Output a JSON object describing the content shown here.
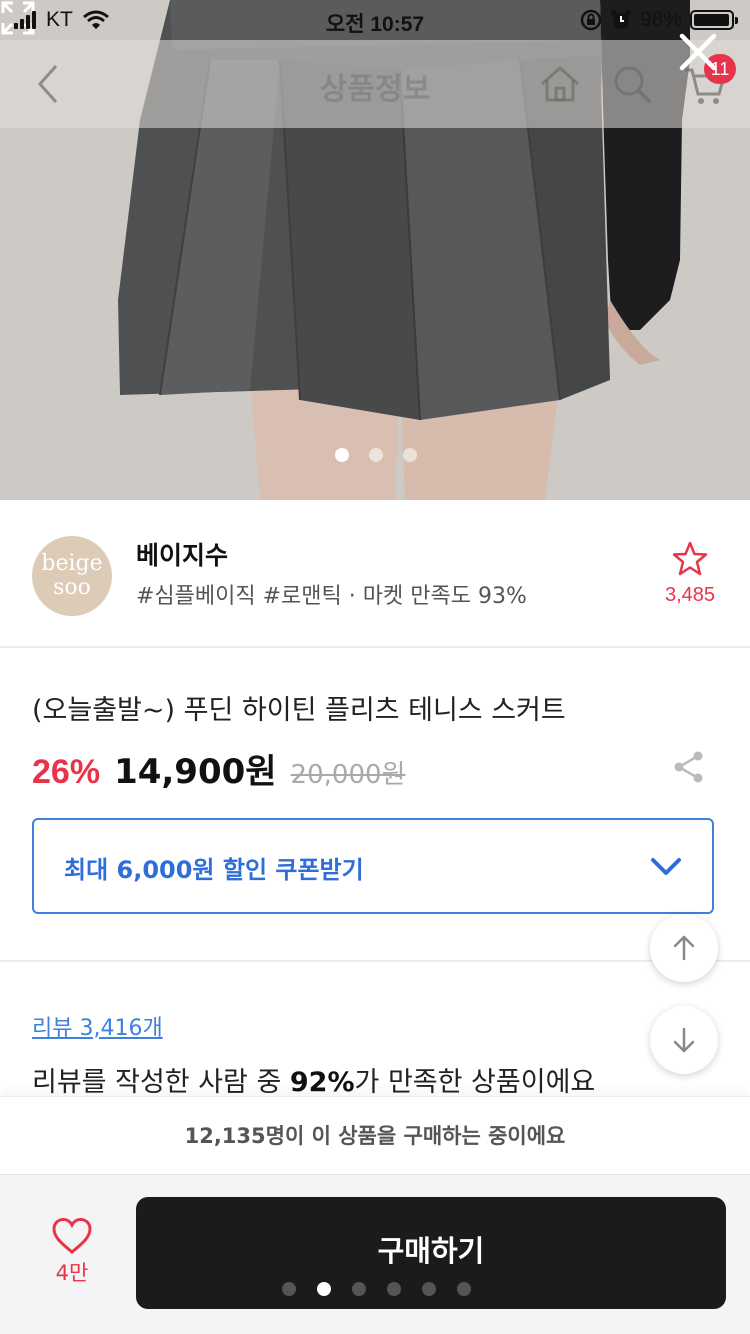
{
  "status_bar": {
    "carrier": "KT",
    "time": "오전 10:57",
    "battery": "98%",
    "battery_level": 0.98
  },
  "nav": {
    "title": "상품정보",
    "cart_badge": "11"
  },
  "hero": {
    "image_count": 3,
    "active_index": 0
  },
  "store": {
    "logo_line1": "beige",
    "logo_line2": "soo",
    "name": "베이지수",
    "tags": "#심플베이직 #로맨틱 · 마켓 만족도 93%",
    "favorite_count": "3,485"
  },
  "product": {
    "title": "(오늘출발~) 푸딘 하이틴 플리츠 테니스 스커트",
    "discount": "26%",
    "price": "14,900원",
    "original_price": "20,000원"
  },
  "coupon": {
    "label": "최대 6,000원 할인 쿠폰받기"
  },
  "review": {
    "link": "리뷰 3,416개",
    "text_before": "리뷰를 작성한 사람 중 ",
    "percent": "92%",
    "text_after": "가 만족한 상품이에요"
  },
  "buying_now": "12,135명이 이 상품을 구매하는 중이에요",
  "bottom": {
    "like_count": "4만",
    "buy_label": "구매하기"
  },
  "page_dots": {
    "count": 6,
    "active_index": 1
  },
  "colors": {
    "accent_red": "#e8344b",
    "accent_blue": "#3f7fe0",
    "buy_button": "#1b1b1b"
  }
}
